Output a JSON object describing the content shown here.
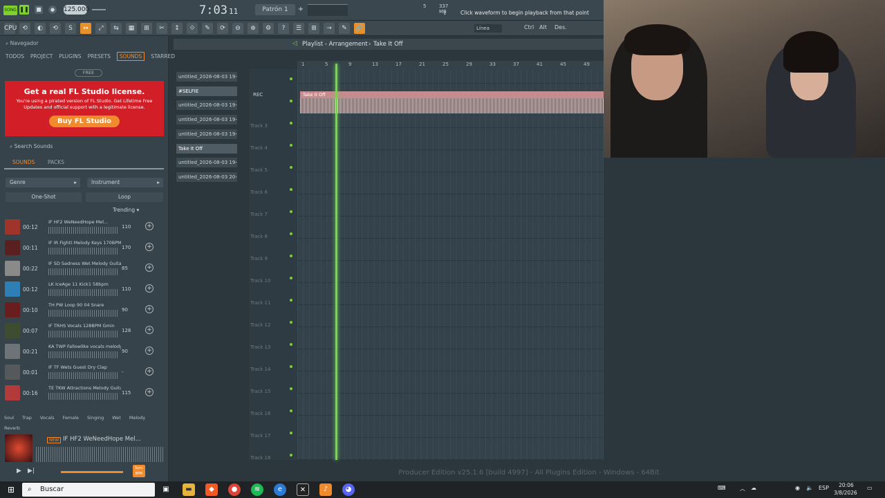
{
  "transport": {
    "tempo": "125.000",
    "time": "7:03",
    "time_sub": "11",
    "pattern": "Patrón 1",
    "cpu": "5",
    "mem": "337 MB",
    "mem_sub": "1",
    "hint": "Click waveform to begin playback from that point",
    "mode_label": "SONG",
    "snap": "Línea"
  },
  "toolbar": {
    "icons": [
      "CPU",
      "⟲",
      "◐",
      "⟲",
      "S",
      "↔",
      "⤢",
      "⇆",
      "▦",
      "⊞",
      "✂",
      "↕",
      "⟐",
      "✎",
      "⟳",
      "⊖",
      "⊕",
      "⚙",
      "?",
      "☰",
      "⊞",
      "→",
      "✎",
      "🔗"
    ],
    "labels": [
      "Ctrl",
      "Alt",
      "Des."
    ]
  },
  "browser": {
    "title": "Navegador",
    "tabs": [
      "TODOS",
      "PROJECT",
      "PLUGINS",
      "PRESETS",
      "SOUNDS",
      "STARRED"
    ],
    "active_tab": "SOUNDS",
    "free_label": "FREE",
    "ad": {
      "headline": "Get a real FL Studio license.",
      "body": "You're using a pirated version of FL Studio. Get Lifetime Free Updates and official support with a legitimate license.",
      "button": "Buy FL Studio"
    },
    "search_placeholder": "Search Sounds",
    "subtabs": [
      "SOUNDS",
      "PACKS"
    ],
    "genre": "Genre",
    "instrument": "Instrument",
    "oneshot": "One-Shot",
    "loop": "Loop",
    "sort": "Trending",
    "sounds": [
      {
        "dur": "00:12",
        "name": "IF HF2 WeNeedHope Mel...",
        "bpm": "110",
        "color": "#a0342a"
      },
      {
        "dur": "00:11",
        "name": "IF IR Fightt Melody Keys 170BPM...",
        "bpm": "170",
        "color": "#5a2020"
      },
      {
        "dur": "00:22",
        "name": "IF SD Sadness Wet Melody Guitar...",
        "bpm": "85",
        "color": "#8a8a8a"
      },
      {
        "dur": "00:12",
        "name": "LK IceAge 11 Kick1 58bpm",
        "bpm": "110",
        "color": "#2d7fb6"
      },
      {
        "dur": "00:10",
        "name": "TH PW Loop 90 04 Snare",
        "bpm": "90",
        "color": "#6a1d1d"
      },
      {
        "dur": "00:07",
        "name": "IF TRHS Vocals 128BPM Gmin",
        "bpm": "128",
        "color": "#3e4d30"
      },
      {
        "dur": "00:21",
        "name": "KA TWP Fallowlike vocals melody...",
        "bpm": "90",
        "color": "#6e7378"
      },
      {
        "dur": "00:01",
        "name": "IF TF Wets Guest Dry Clap",
        "bpm": "-",
        "color": "#55595c"
      },
      {
        "dur": "00:16",
        "name": "TE TKW Attractions Melody Guitar...",
        "bpm": "115",
        "color": "#b23a3a"
      }
    ],
    "tags": [
      "Soul",
      "Trap",
      "Vocals",
      "Female",
      "Singing",
      "Wet",
      "Melody",
      "Reverb"
    ],
    "preview": {
      "new": "NEW",
      "name": "IF HF2 WeNeedHope Mel...",
      "sync": "Sync BPM"
    }
  },
  "patterns": [
    "untitled_2026-08-03 19-...",
    "#SELFIE",
    "untitled_2026-08-03 19-...",
    "untitled_2026-08-03 19-...",
    "untitled_2026-08-03 19-...",
    "Take It Off",
    "untitled_2026-08-03 19-...",
    "untitled_2026-08-03 20-..."
  ],
  "playlist": {
    "title": "Playlist - Arrangement",
    "crumb": "Take It Off",
    "rec": "REC",
    "ruler": [
      "1",
      "5",
      "9",
      "13",
      "17",
      "21",
      "25",
      "29",
      "33",
      "37",
      "41",
      "45",
      "49"
    ],
    "clip_name": "Take It Off",
    "tracks": [
      "",
      "",
      "Track 3",
      "Track 4",
      "Track 5",
      "Track 6",
      "Track 7",
      "Track 8",
      "Track 9",
      "Track 10",
      "Track 11",
      "Track 12",
      "Track 13",
      "Track 14",
      "Track 15",
      "Track 16",
      "Track 17",
      "Track 18"
    ]
  },
  "status": "Producer Edition v25.1.6 [build 4997] - All Plugins Edition - Windows - 64Bit",
  "taskbar": {
    "search": "Buscar",
    "lang": "ESP",
    "time": "20:06",
    "date": "3/8/2026"
  }
}
